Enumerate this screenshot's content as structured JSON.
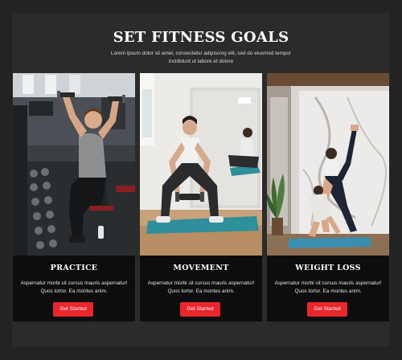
{
  "header": {
    "title": "SET FITNESS GOALS",
    "subtitle": "Lorem ipsum dolor sit amet, consectetur adipiscing elit, sed do eiusmod tempor incididunt ut labore et dolore"
  },
  "cards": [
    {
      "title": "PRACTICE",
      "text": "Aspernatur morbi sit cursus mauris aspernatur! Quos tortor. Ea montes anim.",
      "button_label": "Get Started",
      "image": "man-lifting-dumbbells-gym"
    },
    {
      "title": "MOVEMENT",
      "text": "Aspernatur morbi sit cursus mauris aspernatur! Quos tortor. Ea montes anim.",
      "button_label": "Get Started",
      "image": "woman-squat-kettlebell"
    },
    {
      "title": "WEIGHT LOSS",
      "text": "Aspernatur morbi sit cursus mauris aspernatur! Quos tortor. Ea montes anim.",
      "button_label": "Get Started",
      "image": "two-women-stretching"
    }
  ],
  "colors": {
    "background": "#232323",
    "card": "#0d0d0d",
    "accent": "#e8262c",
    "text": "#ffffff"
  }
}
